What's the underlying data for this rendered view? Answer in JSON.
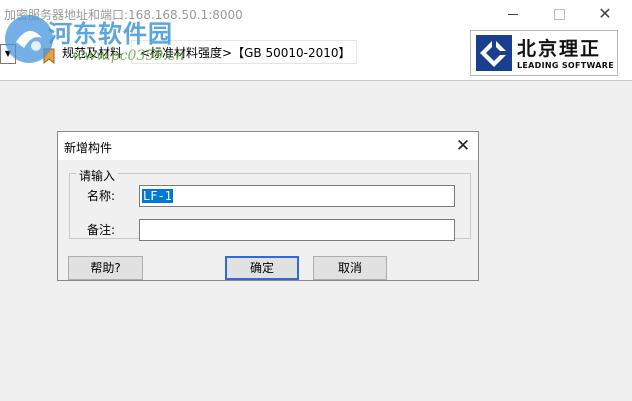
{
  "window": {
    "title": "加密服务器地址和端口:168.168.50.1:8000",
    "minimize_label": "",
    "close_label": "✕"
  },
  "watermark": {
    "text": "河东软件园",
    "url": "www.pc0359.cn"
  },
  "toolbar": {
    "dropdown_glyph": "▼",
    "norms_menu_label": "规范及材料",
    "spec_text": "<标准材料强度>【GB 50010-2010】",
    "logo_cn": "北京理正",
    "logo_en": "LEADING SOFTWARE"
  },
  "dialog": {
    "title": "新增构件",
    "close_glyph": "✕",
    "group_label": "请输入",
    "name_label": "名称:",
    "name_value": "LF-1",
    "note_label": "备注:",
    "note_value": "",
    "help_button": "帮助?",
    "ok_button": "确定",
    "cancel_button": "取消"
  },
  "colors": {
    "selection": "#0078d7",
    "window_bg": "#f0f0f0",
    "watermark_blue": "#4096d7",
    "watermark_green": "#5aaa3c"
  }
}
